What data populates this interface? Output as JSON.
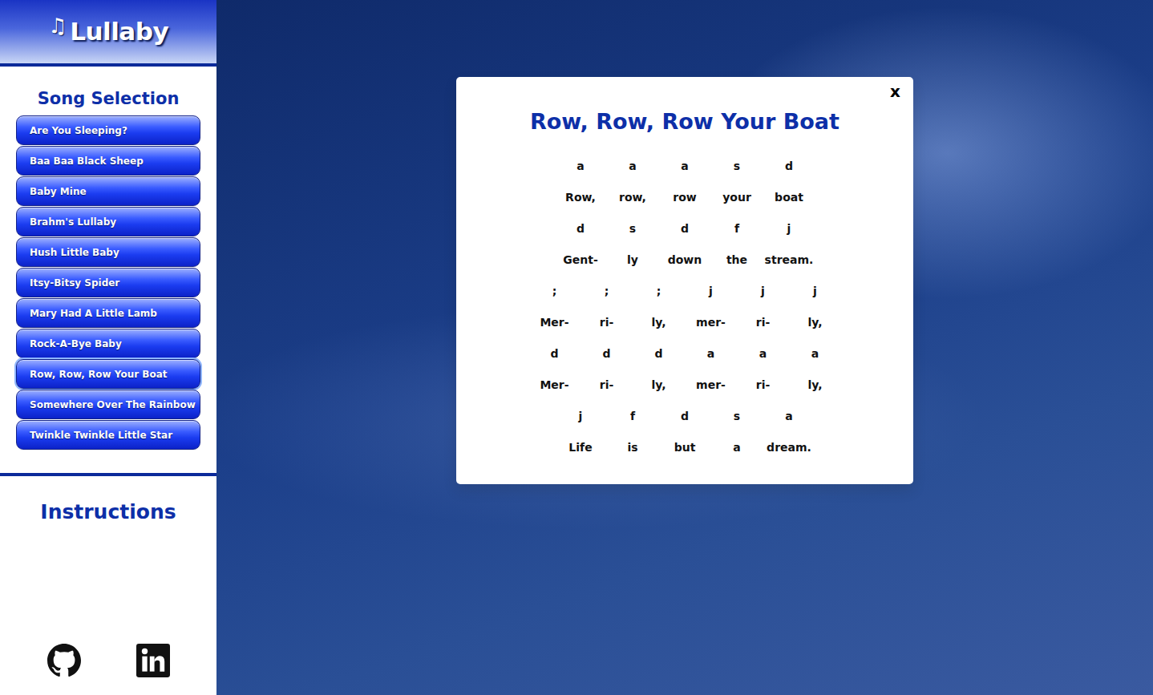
{
  "app": {
    "logo_icon": "♫",
    "title": "Lullaby"
  },
  "sidebar": {
    "heading": "Song Selection",
    "songs": [
      {
        "label": "Are You Sleeping?",
        "selected": false
      },
      {
        "label": "Baa Baa Black Sheep",
        "selected": false
      },
      {
        "label": "Baby Mine",
        "selected": false
      },
      {
        "label": "Brahm's Lullaby",
        "selected": false
      },
      {
        "label": "Hush Little Baby",
        "selected": false
      },
      {
        "label": "Itsy-Bitsy Spider",
        "selected": false
      },
      {
        "label": "Mary Had A Little Lamb",
        "selected": false
      },
      {
        "label": "Rock-A-Bye Baby",
        "selected": false
      },
      {
        "label": "Row, Row, Row Your Boat",
        "selected": true
      },
      {
        "label": "Somewhere Over The Rainbow",
        "selected": false
      },
      {
        "label": "Twinkle Twinkle Little Star",
        "selected": false
      }
    ],
    "instructions": "Instructions"
  },
  "dialog": {
    "title": "Row, Row, Row Your Boat",
    "close": "x",
    "lines": [
      {
        "notes": [
          "a",
          "a",
          "a",
          "s",
          "d"
        ],
        "words": [
          "Row,",
          "row,",
          "row",
          "your",
          "boat"
        ]
      },
      {
        "notes": [
          "d",
          "s",
          "d",
          "f",
          "j"
        ],
        "words": [
          "Gent-",
          "ly",
          "down",
          "the",
          "stream."
        ]
      },
      {
        "notes": [
          ";",
          ";",
          ";",
          "j",
          "j",
          "j"
        ],
        "words": [
          "Mer-",
          "ri-",
          "ly,",
          "mer-",
          "ri-",
          "ly,"
        ]
      },
      {
        "notes": [
          "d",
          "d",
          "d",
          "a",
          "a",
          "a"
        ],
        "words": [
          "Mer-",
          "ri-",
          "ly,",
          "mer-",
          "ri-",
          "ly,"
        ]
      },
      {
        "notes": [
          "j",
          "f",
          "d",
          "s",
          "a"
        ],
        "words": [
          "Life",
          "is",
          "but",
          "a",
          "dream."
        ]
      }
    ]
  }
}
